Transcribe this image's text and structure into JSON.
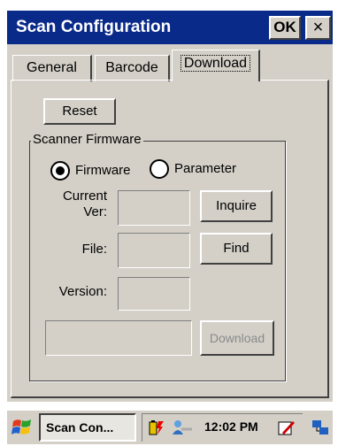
{
  "window": {
    "title": "Scan Configuration",
    "ok_label": "OK",
    "close_label": "×"
  },
  "tabs": [
    {
      "label": "General",
      "active": false
    },
    {
      "label": "Barcode",
      "active": false
    },
    {
      "label": "Download",
      "active": true
    }
  ],
  "download_panel": {
    "reset_label": "Reset",
    "group_label": "Scanner Firmware",
    "radio_options": [
      {
        "label": "Firmware",
        "selected": true
      },
      {
        "label": "Parameter",
        "selected": false
      }
    ],
    "current_ver_label_line1": "Current",
    "current_ver_label_line2": "Ver:",
    "current_ver_value": "",
    "inquire_label": "Inquire",
    "file_label": "File:",
    "file_value": "",
    "find_label": "Find",
    "version_label": "Version:",
    "version_value": "",
    "download_path_value": "",
    "download_label": "Download",
    "download_enabled": false
  },
  "taskbar": {
    "start_icon": "windows-flag-icon",
    "active_task_label": "Scan Con...",
    "tray_icons": [
      "battery-charging-icon",
      "network-people-icon"
    ],
    "clock": "12:02 PM",
    "input_icon": "input-panel-icon",
    "desktop_icon": "connectivity-icon"
  }
}
